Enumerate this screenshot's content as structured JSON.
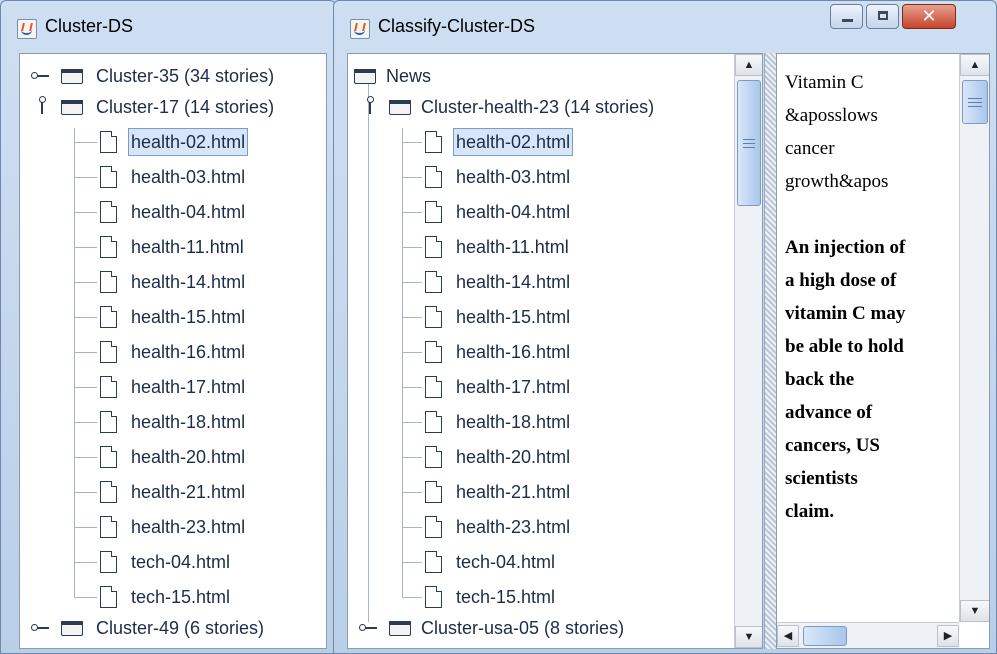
{
  "window_a": {
    "title": "Cluster-DS",
    "tree": {
      "cluster_35": "Cluster-35 (34 stories)",
      "cluster_17": "Cluster-17 (14 stories)",
      "files": [
        "health-02.html",
        "health-03.html",
        "health-04.html",
        "health-11.html",
        "health-14.html",
        "health-15.html",
        "health-16.html",
        "health-17.html",
        "health-18.html",
        "health-20.html",
        "health-21.html",
        "health-23.html",
        "tech-04.html",
        "tech-15.html"
      ],
      "selected_file": "health-02.html",
      "cluster_49": "Cluster-49 (6 stories)"
    }
  },
  "window_b": {
    "title": "Classify-Cluster-DS",
    "caption_buttons": {
      "minimize": "minimize-icon",
      "maximize": "maximize-icon",
      "close": "✕"
    },
    "tree": {
      "root": "News",
      "cluster_health_23": "Cluster-health-23 (14 stories)",
      "files": [
        "health-02.html",
        "health-03.html",
        "health-04.html",
        "health-11.html",
        "health-14.html",
        "health-15.html",
        "health-16.html",
        "health-17.html",
        "health-18.html",
        "health-20.html",
        "health-21.html",
        "health-23.html",
        "tech-04.html",
        "tech-15.html"
      ],
      "selected_file": "health-02.html",
      "cluster_usa_05": "Cluster-usa-05 (8 stories)"
    },
    "article": {
      "headline": "Vitamin C\n&aposslows\ncancer\ngrowth&apos",
      "body": "An injection of\na high dose of\nvitamin C may\nbe able to hold\nback the\nadvance of\ncancers, US\nscientists\nclaim."
    },
    "scroll": {
      "up": "▲",
      "down": "▼",
      "left": "◀",
      "right": "▶"
    }
  },
  "colors": {
    "selection": "#d6e5f7",
    "selection_border": "#7a9cc8",
    "frame": "#b9cfe8",
    "close_button": "#c8442b"
  }
}
